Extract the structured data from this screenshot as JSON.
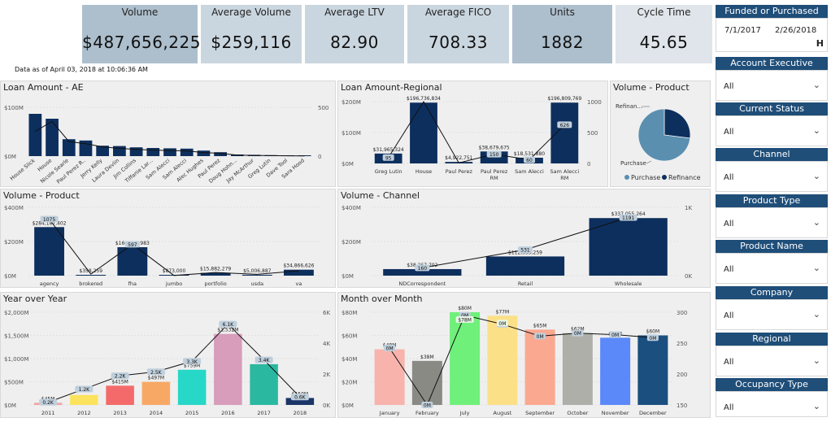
{
  "kpis": [
    {
      "label": "Volume",
      "value": "$487,656,225",
      "bg": "#adbfcd"
    },
    {
      "label": "Average Volume",
      "value": "$259,116",
      "bg": "#cad6df"
    },
    {
      "label": "Average LTV",
      "value": "82.90",
      "bg": "#cad6df"
    },
    {
      "label": "Average FICO",
      "value": "708.33",
      "bg": "#cad6df"
    },
    {
      "label": "Units",
      "value": "1882",
      "bg": "#adbfcd"
    },
    {
      "label": "Cycle Time",
      "value": "45.65",
      "bg": "#dfe5ea"
    }
  ],
  "as_of": "Data as of April 03, 2018 at 10:06:36 AM",
  "colors": {
    "navy": "#0d2f5e",
    "bar_label_bg": "#bfcfdc",
    "slicer_header": "#1f4e79",
    "pie_light": "#5a8fb0"
  },
  "date_slicer": {
    "title": "Funded or Purchased Date",
    "start": "7/1/2017",
    "end": "2/26/2018"
  },
  "slicers": [
    {
      "title": "Account Executive",
      "value": "All"
    },
    {
      "title": "Current Status",
      "value": "All"
    },
    {
      "title": "Channel",
      "value": "All"
    },
    {
      "title": "Product Type",
      "value": "All"
    },
    {
      "title": "Product Name",
      "value": "All"
    },
    {
      "title": "Company",
      "value": "All"
    },
    {
      "title": "Regional",
      "value": "All"
    },
    {
      "title": "Occupancy Type",
      "value": "All"
    }
  ],
  "chart_data": [
    {
      "id": "loan_ae",
      "type": "bar",
      "title": "Loan Amount - AE",
      "categories": [
        "House Slick",
        "House",
        "Nicole Searle",
        "Paul Perez R..",
        "Jerry Kelly",
        "Laura Devlin",
        "Jim Collins",
        "Tiffanie Lar...",
        "Sam Alecci",
        "Sam Alecci",
        "Alec Hughes",
        "Paul Perez",
        "Doug Hohn...",
        "Jay McArthur",
        "Greg Lutin",
        "Dave Tool",
        "Sara Hood"
      ],
      "series": [
        {
          "values": [
            130,
            115,
            52,
            48,
            32,
            31,
            27,
            25,
            24,
            23,
            17,
            12,
            5,
            4,
            3,
            2,
            1
          ]
        },
        {
          "values": [
            290,
            405,
            170,
            145,
            108,
            90,
            78,
            70,
            65,
            60,
            42,
            32,
            12,
            8,
            6,
            4,
            2
          ]
        }
      ],
      "ylabels": [
        "$100M",
        "$0M"
      ],
      "y2labels": [
        "500",
        "0"
      ]
    },
    {
      "id": "loan_regional",
      "type": "bar",
      "title": "Loan Amount-Regional",
      "categories": [
        "Greg Lutin",
        "House",
        "Paul Perez",
        "Paul Perez RM",
        "Sam Alecci",
        "Sam Alecci RM"
      ],
      "series": [
        {
          "values": [
            31.965324,
            196.736834,
            4.922751,
            38.679675,
            18.53188,
            196.809769
          ]
        },
        {
          "values": [
            95,
            1000,
            9,
            150,
            60,
            626
          ]
        }
      ],
      "data_labels": [
        "$31,965,324",
        "$196,736,834",
        "$4,922,751",
        "$38,679,675",
        "$18,531,880",
        "$196,809,769"
      ],
      "count_labels": [
        "95",
        "",
        "",
        "150",
        "60",
        "626"
      ],
      "ylabels": [
        "$200M",
        "$100M",
        "$0M"
      ],
      "y2labels": [
        "1000",
        "500",
        "0"
      ]
    },
    {
      "id": "volume_product_pie",
      "type": "pie",
      "title": "Volume - Product",
      "slices": [
        {
          "label": "Purchase",
          "value": 73
        },
        {
          "label": "Refinance",
          "value": 27
        }
      ],
      "labels": [
        "Refinan...",
        "Purchase"
      ],
      "legend": [
        "Purchase",
        "Refinance"
      ]
    },
    {
      "id": "volume_product",
      "type": "bar",
      "title": "Volume - Product",
      "categories": [
        "agency",
        "brokered",
        "fha",
        "jumbo",
        "portfolio",
        "usda",
        "va"
      ],
      "series": [
        {
          "values": [
            284.187402,
            0.358259,
            166.505983,
            0.873,
            15.882279,
            5.006887,
            34.866626
          ]
        },
        {
          "values": [
            1075,
            30,
            597,
            3,
            60,
            25,
            90
          ]
        }
      ],
      "data_labels": [
        "$284,187,402",
        "$358,259",
        "$166,505,983",
        "$873,000",
        "$15,882,279",
        "$5,006,887",
        "$34,866,626"
      ],
      "count_labels": [
        "1075",
        "",
        "597",
        "",
        "",
        "",
        ""
      ],
      "ylabels": [
        "$400M",
        "$200M",
        "$0M"
      ]
    },
    {
      "id": "volume_channel",
      "type": "bar",
      "title": "Volume - Channel",
      "categories": [
        "NDCorrespondent",
        "Retail",
        "Wholesale"
      ],
      "series": [
        {
          "values": [
            38.267702,
            112.333259,
            337.055264
          ]
        },
        {
          "values": [
            160,
            531,
            1191
          ]
        }
      ],
      "data_labels": [
        "$38,267,702",
        "$112,333,259",
        "$337,055,264"
      ],
      "count_labels": [
        "160",
        "531",
        "1191"
      ],
      "ylabels": [
        "$400M",
        "$200M",
        "$0M"
      ],
      "y2labels": [
        "1K",
        "0K"
      ]
    },
    {
      "id": "year_over_year",
      "type": "bar",
      "title": "Year over Year",
      "categories": [
        "2011",
        "2012",
        "2013",
        "2014",
        "2015",
        "2016",
        "2017",
        "2018"
      ],
      "series": [
        {
          "values": [
            45,
            215,
            415,
            497,
            759,
            1532,
            879,
            150
          ]
        },
        {
          "values": [
            0.2,
            1.2,
            2.2,
            2.5,
            3.3,
            6.1,
            3.4,
            0.6
          ]
        }
      ],
      "colors": [
        "#f4a1a1",
        "#fce35e",
        "#f46a6a",
        "#f8a865",
        "#27d7c7",
        "#d79dba",
        "#2ab9a0",
        "#1a3566"
      ],
      "data_labels": [
        "$45M",
        "$215M",
        "$415M",
        "$497M",
        "$759M",
        "$1,532M",
        "$879M",
        "$150M"
      ],
      "count_labels": [
        "0.2K",
        "1.2K",
        "2.2K",
        "2.5K",
        "3.3K",
        "6.1K",
        "3.4K",
        "0.6K"
      ],
      "ylabels": [
        "$2,000M",
        "$1,500M",
        "$1,000M",
        "$500M",
        "$0M"
      ],
      "y2labels": [
        "6K",
        "4K",
        "2K",
        "0K"
      ]
    },
    {
      "id": "month_over_month",
      "type": "bar",
      "title": "Month over Month",
      "categories": [
        "January",
        "February",
        "July",
        "August",
        "September",
        "October",
        "November",
        "December"
      ],
      "series": [
        {
          "values": [
            48,
            38,
            80,
            77,
            65,
            62,
            58,
            60
          ]
        },
        {
          "values": [
            190,
            0,
            300,
            270,
            230,
            240,
            235,
            225
          ]
        }
      ],
      "colors": [
        "#f8b3ad",
        "#8a8a84",
        "#6ff07a",
        "#fce087",
        "#fba890",
        "#afafa9",
        "#5b89fa",
        "#1a4f80"
      ],
      "data_labels": [
        "$48M",
        "$38M",
        "$80M",
        "$77M",
        "$65M",
        "$62M",
        "$58M",
        "$60M"
      ],
      "count_labels": [
        "0M",
        "0M",
        "0M",
        "0M",
        "0M",
        "0M",
        "0M",
        "0M"
      ],
      "top_labels": [
        "",
        "",
        "$78M",
        "0M",
        "",
        "",
        "",
        ""
      ],
      "ylabels": [
        "$80M",
        "$60M",
        "$40M",
        "$20M",
        "$0M"
      ],
      "y2labels": [
        "300",
        "250",
        "200",
        "150"
      ]
    }
  ]
}
